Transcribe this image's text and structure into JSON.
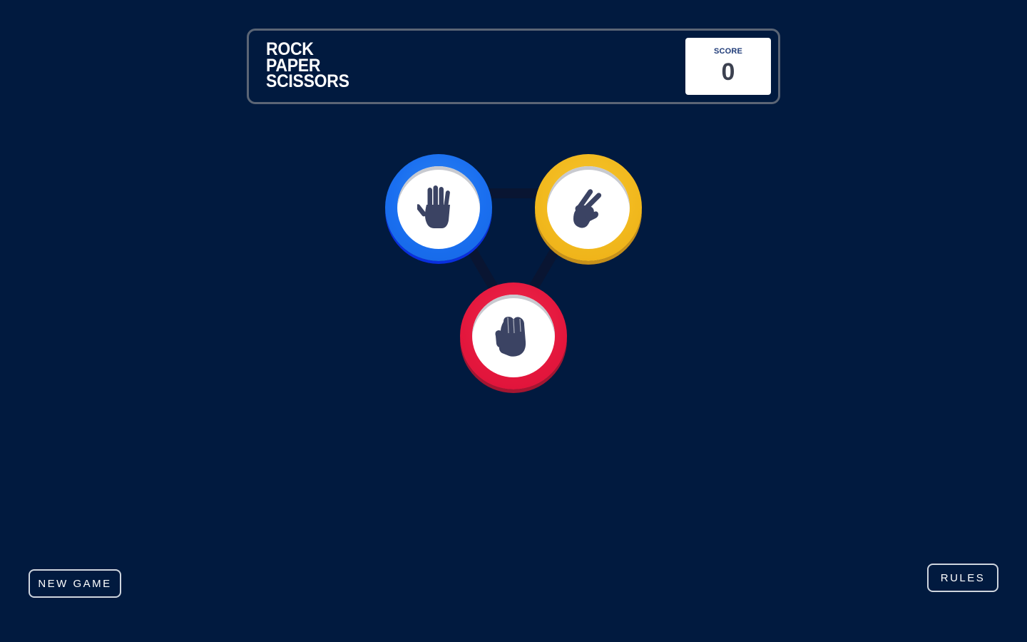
{
  "header": {
    "title_lines": [
      "ROCK",
      "PAPER",
      "SCISSORS"
    ],
    "score_label": "SCORE",
    "score_value": "0"
  },
  "tokens": {
    "paper": {
      "icon": "paper-hand-icon",
      "ring_color": "#1a6ff0"
    },
    "scissors": {
      "icon": "scissors-hand-icon",
      "ring_color": "#f1b81d"
    },
    "rock": {
      "icon": "rock-fist-icon",
      "ring_color": "#e4173d"
    }
  },
  "buttons": {
    "new_game_label": "NEW GAME",
    "rules_label": "RULES"
  },
  "colors": {
    "background": "#011a3f",
    "header_border": "#5b6575",
    "icon_fill": "#3b4363"
  }
}
